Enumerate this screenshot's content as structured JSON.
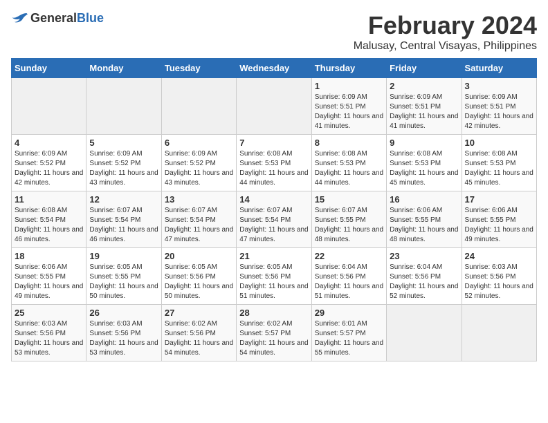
{
  "logo": {
    "general": "General",
    "blue": "Blue"
  },
  "title": "February 2024",
  "subtitle": "Malusay, Central Visayas, Philippines",
  "days_of_week": [
    "Sunday",
    "Monday",
    "Tuesday",
    "Wednesday",
    "Thursday",
    "Friday",
    "Saturday"
  ],
  "weeks": [
    [
      {
        "day": "",
        "detail": ""
      },
      {
        "day": "",
        "detail": ""
      },
      {
        "day": "",
        "detail": ""
      },
      {
        "day": "",
        "detail": ""
      },
      {
        "day": "1",
        "detail": "Sunrise: 6:09 AM\nSunset: 5:51 PM\nDaylight: 11 hours and 41 minutes."
      },
      {
        "day": "2",
        "detail": "Sunrise: 6:09 AM\nSunset: 5:51 PM\nDaylight: 11 hours and 41 minutes."
      },
      {
        "day": "3",
        "detail": "Sunrise: 6:09 AM\nSunset: 5:51 PM\nDaylight: 11 hours and 42 minutes."
      }
    ],
    [
      {
        "day": "4",
        "detail": "Sunrise: 6:09 AM\nSunset: 5:52 PM\nDaylight: 11 hours and 42 minutes."
      },
      {
        "day": "5",
        "detail": "Sunrise: 6:09 AM\nSunset: 5:52 PM\nDaylight: 11 hours and 43 minutes."
      },
      {
        "day": "6",
        "detail": "Sunrise: 6:09 AM\nSunset: 5:52 PM\nDaylight: 11 hours and 43 minutes."
      },
      {
        "day": "7",
        "detail": "Sunrise: 6:08 AM\nSunset: 5:53 PM\nDaylight: 11 hours and 44 minutes."
      },
      {
        "day": "8",
        "detail": "Sunrise: 6:08 AM\nSunset: 5:53 PM\nDaylight: 11 hours and 44 minutes."
      },
      {
        "day": "9",
        "detail": "Sunrise: 6:08 AM\nSunset: 5:53 PM\nDaylight: 11 hours and 45 minutes."
      },
      {
        "day": "10",
        "detail": "Sunrise: 6:08 AM\nSunset: 5:53 PM\nDaylight: 11 hours and 45 minutes."
      }
    ],
    [
      {
        "day": "11",
        "detail": "Sunrise: 6:08 AM\nSunset: 5:54 PM\nDaylight: 11 hours and 46 minutes."
      },
      {
        "day": "12",
        "detail": "Sunrise: 6:07 AM\nSunset: 5:54 PM\nDaylight: 11 hours and 46 minutes."
      },
      {
        "day": "13",
        "detail": "Sunrise: 6:07 AM\nSunset: 5:54 PM\nDaylight: 11 hours and 47 minutes."
      },
      {
        "day": "14",
        "detail": "Sunrise: 6:07 AM\nSunset: 5:54 PM\nDaylight: 11 hours and 47 minutes."
      },
      {
        "day": "15",
        "detail": "Sunrise: 6:07 AM\nSunset: 5:55 PM\nDaylight: 11 hours and 48 minutes."
      },
      {
        "day": "16",
        "detail": "Sunrise: 6:06 AM\nSunset: 5:55 PM\nDaylight: 11 hours and 48 minutes."
      },
      {
        "day": "17",
        "detail": "Sunrise: 6:06 AM\nSunset: 5:55 PM\nDaylight: 11 hours and 49 minutes."
      }
    ],
    [
      {
        "day": "18",
        "detail": "Sunrise: 6:06 AM\nSunset: 5:55 PM\nDaylight: 11 hours and 49 minutes."
      },
      {
        "day": "19",
        "detail": "Sunrise: 6:05 AM\nSunset: 5:55 PM\nDaylight: 11 hours and 50 minutes."
      },
      {
        "day": "20",
        "detail": "Sunrise: 6:05 AM\nSunset: 5:56 PM\nDaylight: 11 hours and 50 minutes."
      },
      {
        "day": "21",
        "detail": "Sunrise: 6:05 AM\nSunset: 5:56 PM\nDaylight: 11 hours and 51 minutes."
      },
      {
        "day": "22",
        "detail": "Sunrise: 6:04 AM\nSunset: 5:56 PM\nDaylight: 11 hours and 51 minutes."
      },
      {
        "day": "23",
        "detail": "Sunrise: 6:04 AM\nSunset: 5:56 PM\nDaylight: 11 hours and 52 minutes."
      },
      {
        "day": "24",
        "detail": "Sunrise: 6:03 AM\nSunset: 5:56 PM\nDaylight: 11 hours and 52 minutes."
      }
    ],
    [
      {
        "day": "25",
        "detail": "Sunrise: 6:03 AM\nSunset: 5:56 PM\nDaylight: 11 hours and 53 minutes."
      },
      {
        "day": "26",
        "detail": "Sunrise: 6:03 AM\nSunset: 5:56 PM\nDaylight: 11 hours and 53 minutes."
      },
      {
        "day": "27",
        "detail": "Sunrise: 6:02 AM\nSunset: 5:56 PM\nDaylight: 11 hours and 54 minutes."
      },
      {
        "day": "28",
        "detail": "Sunrise: 6:02 AM\nSunset: 5:57 PM\nDaylight: 11 hours and 54 minutes."
      },
      {
        "day": "29",
        "detail": "Sunrise: 6:01 AM\nSunset: 5:57 PM\nDaylight: 11 hours and 55 minutes."
      },
      {
        "day": "",
        "detail": ""
      },
      {
        "day": "",
        "detail": ""
      }
    ]
  ]
}
